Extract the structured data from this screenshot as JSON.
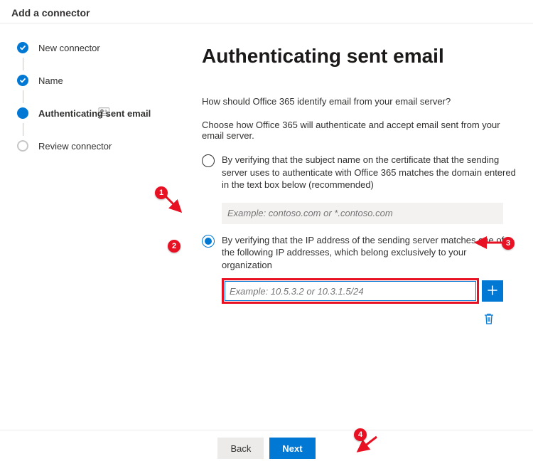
{
  "header": {
    "title": "Add a connector"
  },
  "sidebar": {
    "steps": {
      "0": {
        "label": "New connector"
      },
      "1": {
        "label": "Name"
      },
      "2": {
        "label": "Authenticating sent email"
      },
      "3": {
        "label": "Review connector"
      }
    }
  },
  "main": {
    "title": "Authenticating sent email",
    "question": "How should Office 365 identify email from your email server?",
    "instruction": "Choose how Office 365 will authenticate and accept email sent from your email server.",
    "opt1": {
      "label": "By verifying that the subject name on the certificate that the sending server uses to authenticate with Office 365 matches the domain entered in the text box below (recommended)",
      "placeholder": "Example: contoso.com or *.contoso.com"
    },
    "opt2": {
      "label": "By verifying that the IP address of the sending server matches one of the following IP addresses, which belong exclusively to your organization",
      "placeholder": "Example: 10.5.3.2 or 10.3.1.5/24"
    }
  },
  "footer": {
    "back": "Back",
    "next": "Next"
  },
  "annotations": {
    "a1": "1",
    "a2": "2",
    "a3": "3",
    "a4": "4"
  }
}
